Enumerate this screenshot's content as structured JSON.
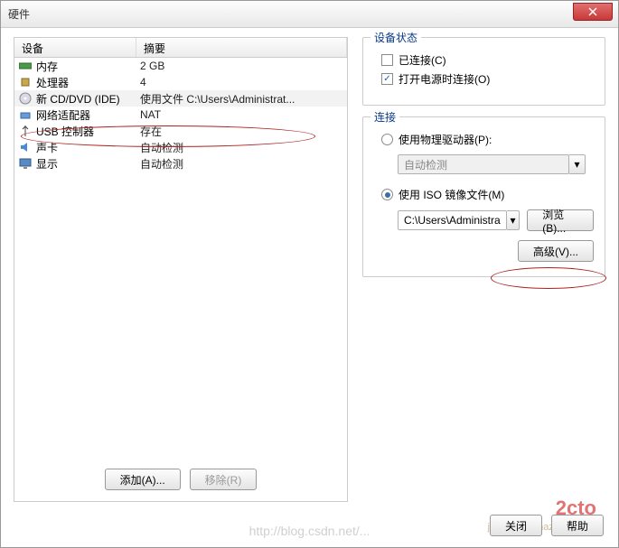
{
  "window": {
    "title": "硬件"
  },
  "grid": {
    "headers": {
      "device": "设备",
      "summary": "摘要"
    },
    "rows": [
      {
        "icon": "memory-icon",
        "name": "内存",
        "summary": "2 GB",
        "selected": false
      },
      {
        "icon": "cpu-icon",
        "name": "处理器",
        "summary": "4",
        "selected": false
      },
      {
        "icon": "disc-icon",
        "name": "新 CD/DVD (IDE)",
        "summary": "使用文件 C:\\Users\\Administrat...",
        "selected": true
      },
      {
        "icon": "net-icon",
        "name": "网络适配器",
        "summary": "NAT",
        "selected": false
      },
      {
        "icon": "usb-icon",
        "name": "USB 控制器",
        "summary": "存在",
        "selected": false
      },
      {
        "icon": "sound-icon",
        "name": "声卡",
        "summary": "自动检测",
        "selected": false
      },
      {
        "icon": "display-icon",
        "name": "显示",
        "summary": "自动检测",
        "selected": false
      }
    ],
    "buttons": {
      "add": "添加(A)...",
      "remove": "移除(R)"
    }
  },
  "status_group": {
    "title": "设备状态",
    "connected": {
      "label": "已连接(C)",
      "checked": false
    },
    "connect_on_power": {
      "label": "打开电源时连接(O)",
      "checked": true
    }
  },
  "connection_group": {
    "title": "连接",
    "physical": {
      "label": "使用物理驱动器(P):",
      "selected": false,
      "value": "自动检测"
    },
    "iso": {
      "label": "使用 ISO 镜像文件(M)",
      "selected": true,
      "value": "C:\\Users\\Administra",
      "browse": "浏览(B)..."
    },
    "advanced": "高级(V)..."
  },
  "footer": {
    "close": "关闭",
    "help": "帮助"
  },
  "watermark": {
    "url": "http://blog.csdn.net/...",
    "brand": "2cto",
    "brand_sub": "jiaocheng.chazidian.com"
  }
}
